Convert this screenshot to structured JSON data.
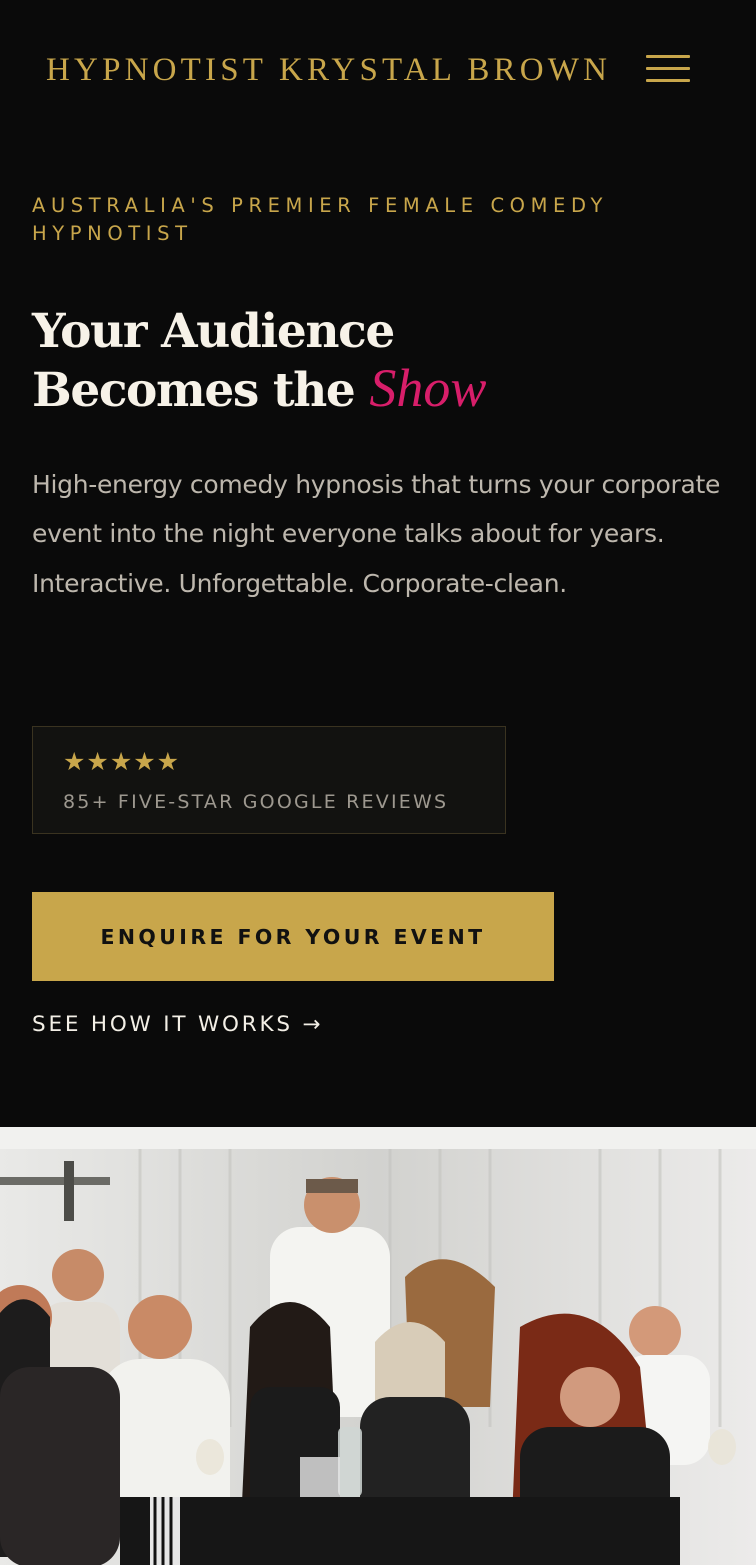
{
  "header": {
    "brand": "HYPNOTIST KRYSTAL BROWN",
    "menu_icon": "hamburger-menu-icon"
  },
  "hero": {
    "eyebrow": "AUSTRALIA'S PREMIER FEMALE COMEDY HYPNOTIST",
    "headline_line1": "Your Audience",
    "headline_line2": "Becomes the",
    "headline_accent": "Show",
    "lead": "High-energy comedy hypnosis that turns your corporate event into the night everyone talks about for years. Interactive. Unforgettable. Corporate-clean.",
    "reviews": {
      "stars": "★★★★★",
      "rating_stars": 5,
      "label": "85+ FIVE-STAR GOOGLE REVIEWS"
    },
    "cta_label": "ENQUIRE FOR YOUR EVENT",
    "secondary_link": "SEE HOW IT WORKS →"
  },
  "colors": {
    "background": "#0a0a0a",
    "gold": "#c8a64b",
    "accent_pink": "#d81e6a",
    "text_light": "#f7f2e8",
    "text_muted": "#bdb7ad"
  }
}
